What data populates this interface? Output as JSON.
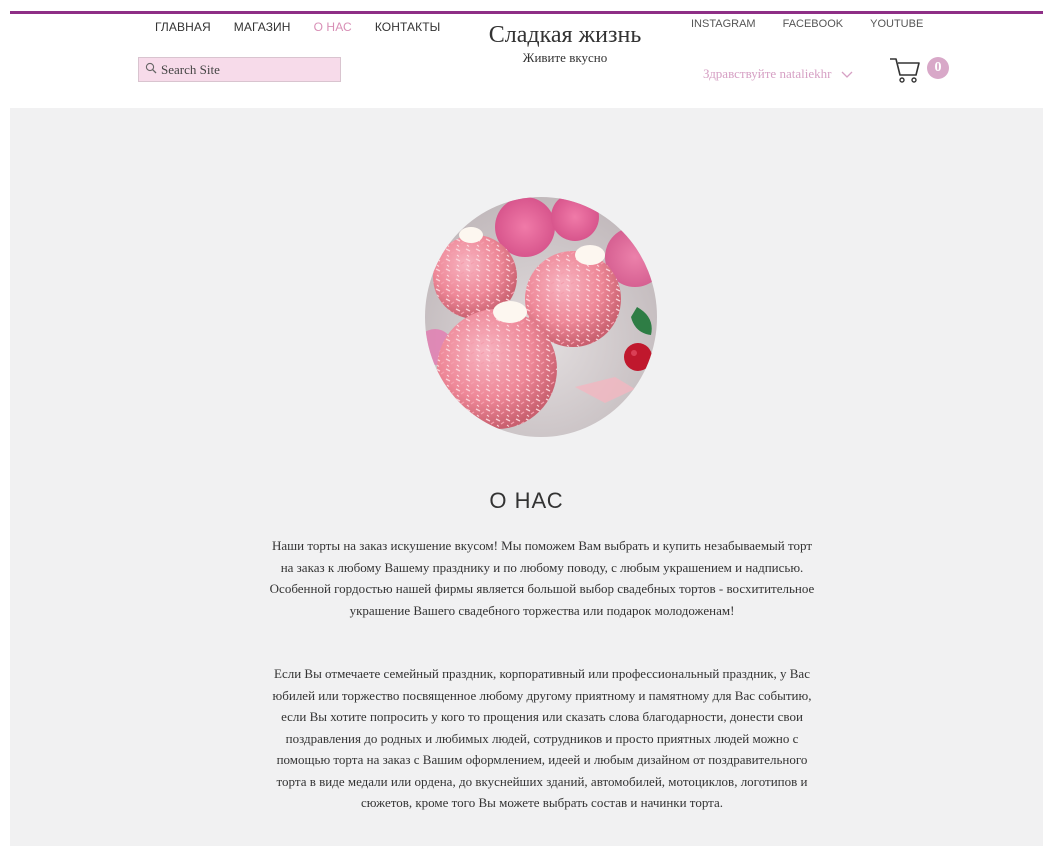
{
  "header": {
    "nav": [
      "ГЛАВНАЯ",
      "МАГАЗИН",
      "О НАС",
      "КОНТАКТЫ"
    ],
    "active_nav": "О НАС",
    "search_placeholder": "Search Site",
    "site_title": "Сладкая жизнь",
    "tagline": "Живите вкусно",
    "social": [
      "INSTAGRAM",
      "FACEBOOK",
      "YOUTUBE"
    ],
    "greeting": "Здравствуйте nataliekhr",
    "cart_count": "0"
  },
  "main": {
    "heading": "О НАС",
    "paragraph1": "Наши торты на заказ искушение вкусом! Мы поможем Вам выбрать и купить незабываемый торт на заказ к любому Вашему празднику и по любому поводу, с любым украшением и надписью. Особенной гордостью нашей фирмы является большой выбор свадебных тортов - восхитительное украшение Вашего свадебного торжества или подарок молодоженам!",
    "paragraph2": "Если Вы отмечаете семейный праздник, корпоративный или профессиональный праздник, у Вас юбилей или торжество посвященное любому другому приятному и памятному для Вас событию, если Вы хотите попросить у кого то прощения или сказать слова благодарности, донести свои поздравления до родных и любимых людей, сотрудников и просто приятных людей можно с помощью торта на заказ с Вашим оформлением, идеей и любым дизайном от поздравительного торта в виде медали или ордена, до вкуснейших зданий, автомобилей, мотоциклов, логотипов и сюжетов, кроме того Вы можете выбрать состав и начинки торта."
  },
  "colors": {
    "accent_line": "#8e2f86",
    "active_link": "#d88fb6",
    "search_bg": "#f7dbea",
    "badge": "#d8a8c8",
    "content_bg": "#f1f1f2"
  }
}
